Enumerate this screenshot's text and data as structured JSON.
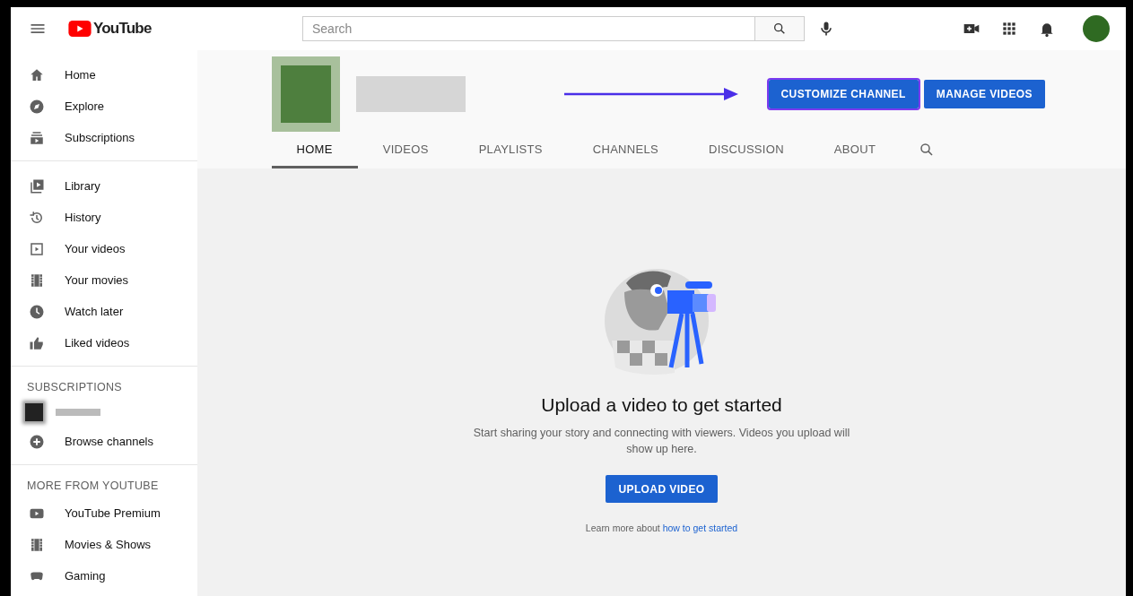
{
  "header": {
    "logo_text": "YouTube",
    "search": {
      "placeholder": "Search"
    }
  },
  "sidebar": {
    "sections": [
      {
        "items": [
          {
            "label": "Home",
            "selected": false
          },
          {
            "label": "Explore",
            "selected": false
          },
          {
            "label": "Subscriptions",
            "selected": false
          }
        ]
      },
      {
        "items": [
          {
            "label": "Library",
            "selected": false
          },
          {
            "label": "History",
            "selected": false
          },
          {
            "label": "Your videos",
            "selected": false
          },
          {
            "label": "Your movies",
            "selected": false
          },
          {
            "label": "Watch later",
            "selected": false
          },
          {
            "label": "Liked videos",
            "selected": false
          }
        ]
      },
      {
        "title": "SUBSCRIPTIONS",
        "has_blurred_channel": true,
        "items": [
          {
            "label": "Browse channels",
            "selected": false
          }
        ]
      },
      {
        "title": "MORE FROM YOUTUBE",
        "items": [
          {
            "label": "YouTube Premium",
            "selected": false
          },
          {
            "label": "Movies & Shows",
            "selected": false
          },
          {
            "label": "Gaming",
            "selected": false
          }
        ]
      }
    ]
  },
  "channel": {
    "buttons": [
      {
        "label": "CUSTOMIZE CHANNEL",
        "highlighted": true
      },
      {
        "label": "MANAGE VIDEOS",
        "highlighted": false
      }
    ],
    "tabs": [
      {
        "label": "HOME",
        "selected": true
      },
      {
        "label": "VIDEOS",
        "selected": false
      },
      {
        "label": "PLAYLISTS",
        "selected": false
      },
      {
        "label": "CHANNELS",
        "selected": false
      },
      {
        "label": "DISCUSSION",
        "selected": false
      },
      {
        "label": "ABOUT",
        "selected": false
      }
    ]
  },
  "empty_state": {
    "title": "Upload a video to get started",
    "description": "Start sharing your story and connecting with viewers. Videos you upload will show up here.",
    "button": "UPLOAD VIDEO",
    "learn_more": "Learn more about",
    "link": "how to get started"
  }
}
